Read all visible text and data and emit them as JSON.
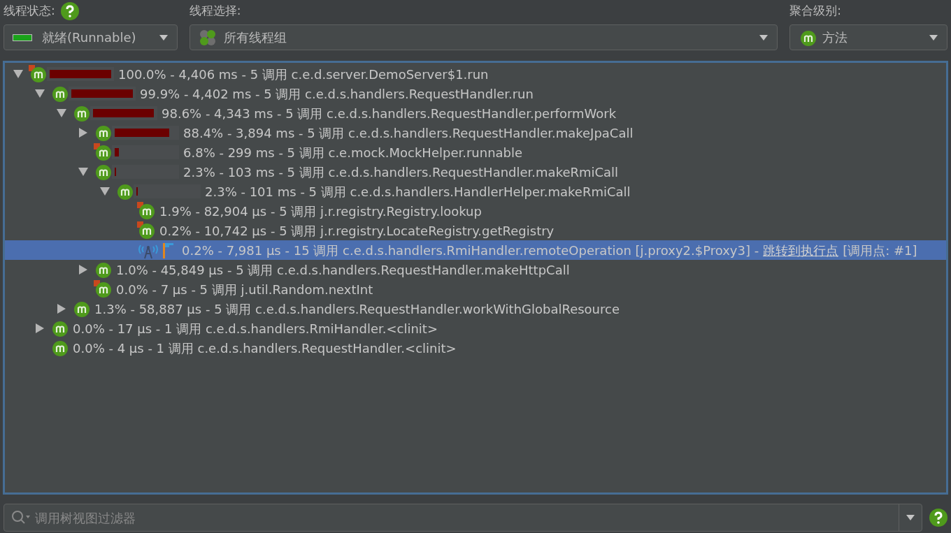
{
  "toolbar": {
    "thread_state": {
      "label": "线程状态:",
      "value": "就绪(Runnable)"
    },
    "thread_selection": {
      "label": "线程选择:",
      "value": "所有线程组"
    },
    "aggregation": {
      "label": "聚合级别:",
      "value": "方法"
    }
  },
  "tree": [
    {
      "kind": "method-hot",
      "expanded": true,
      "leaf": false,
      "selected": false,
      "level": 1.0,
      "text": "100.0% - 4,406 ms - 5 调用 c.e.d.server.DemoServer$1.run",
      "children": [
        {
          "kind": "method",
          "expanded": true,
          "leaf": false,
          "selected": false,
          "level": 0.999,
          "text": "99.9% - 4,402 ms - 5 调用 c.e.d.s.handlers.RequestHandler.run",
          "children": [
            {
              "kind": "method",
              "expanded": true,
              "leaf": false,
              "selected": false,
              "level": 0.986,
              "text": "98.6% - 4,343 ms - 5 调用 c.e.d.s.handlers.RequestHandler.performWork",
              "children": [
                {
                  "kind": "method",
                  "expanded": false,
                  "leaf": false,
                  "selected": false,
                  "level": 0.884,
                  "text": "88.4% - 3,894 ms - 5 调用 c.e.d.s.handlers.RequestHandler.makeJpaCall"
                },
                {
                  "kind": "method-hot",
                  "leaf": true,
                  "selected": false,
                  "level": 0.068,
                  "text": "6.8% - 299 ms - 5 调用 c.e.mock.MockHelper.runnable"
                },
                {
                  "kind": "method",
                  "expanded": true,
                  "leaf": false,
                  "selected": false,
                  "level": 0.023,
                  "text": "2.3% - 103 ms - 5 调用 c.e.d.s.handlers.RequestHandler.makeRmiCall",
                  "children": [
                    {
                      "kind": "method",
                      "expanded": true,
                      "leaf": false,
                      "selected": false,
                      "level": 0.023,
                      "text": "2.3% - 101 ms - 5 调用 c.e.d.s.handlers.HandlerHelper.makeRmiCall",
                      "children": [
                        {
                          "kind": "method-hot",
                          "leaf": true,
                          "selected": false,
                          "text": "1.9% - 82,904 µs - 5 调用 j.r.registry.Registry.lookup"
                        },
                        {
                          "kind": "method-hot",
                          "leaf": true,
                          "selected": false,
                          "text": "0.2% - 10,742 µs - 5 调用 j.r.registry.LocateRegistry.getRegistry"
                        },
                        {
                          "kind": "remote",
                          "leaf": true,
                          "selected": true,
                          "text": "0.2% - 7,981 µs - 15 调用 c.e.d.s.handlers.RmiHandler.remoteOperation [j.proxy2.$Proxy3] -",
                          "link": "跳转到执行点",
                          "suffix": "[调用点: #1]"
                        }
                      ]
                    }
                  ]
                },
                {
                  "kind": "method",
                  "expanded": false,
                  "leaf": false,
                  "selected": false,
                  "text": "1.0% - 45,849 µs - 5 调用 c.e.d.s.handlers.RequestHandler.makeHttpCall"
                },
                {
                  "kind": "method-hot",
                  "leaf": true,
                  "selected": false,
                  "text": "0.0% - 7 µs - 5 调用 j.util.Random.nextInt"
                }
              ]
            },
            {
              "kind": "method",
              "expanded": false,
              "leaf": false,
              "selected": false,
              "text": "1.3% - 58,887 µs - 5 调用 c.e.d.s.handlers.RequestHandler.workWithGlobalResource"
            }
          ]
        },
        {
          "kind": "method",
          "expanded": false,
          "leaf": false,
          "selected": false,
          "text": "0.0% - 17 µs - 1 调用 c.e.d.s.handlers.RmiHandler.<clinit>"
        },
        {
          "kind": "method",
          "leaf": true,
          "selected": false,
          "text": "0.0% - 4 µs - 1 调用 c.e.d.s.handlers.RequestHandler.<clinit>"
        }
      ]
    }
  ],
  "filter": {
    "placeholder": "调用树视图过滤器"
  }
}
